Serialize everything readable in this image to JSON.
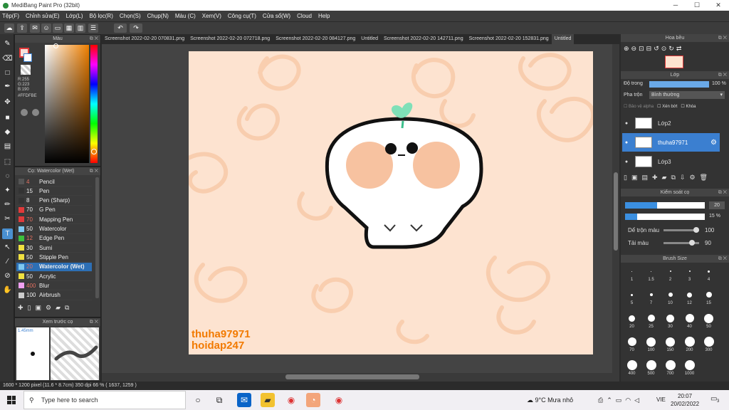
{
  "window": {
    "title": "MediBang Paint Pro (32bit)",
    "minimize": "─",
    "maximize": "☐",
    "close": "✕"
  },
  "menu": [
    "Tệp(F)",
    "Chỉnh sửa(E)",
    "Lớp(L)",
    "Bộ lọc(R)",
    "Chọn(S)",
    "Chụp(N)",
    "Màu (C)",
    "Xem(V)",
    "Công cụ(T)",
    "Cửa sổ(W)",
    "Cloud",
    "Help"
  ],
  "colors": {
    "accent": "#3b7fd0",
    "canvas_bg": "#fde3d0",
    "primary": "#f7e0da",
    "watermark": "#f27a00"
  },
  "color_panel": {
    "title": "Màu",
    "r": "R:255",
    "g": "G:223",
    "b": "B:190",
    "hex": "#FFDFBE"
  },
  "brush_panel": {
    "title": "Cọ: Watercolor (Wet)",
    "items": [
      {
        "size": "4",
        "name": "Pencil",
        "color": "#555555",
        "num_color": "#e07060"
      },
      {
        "size": "15",
        "name": "Pen",
        "color": "#333333",
        "num_color": "#eeeeee"
      },
      {
        "size": "8",
        "name": "Pen (Sharp)",
        "color": "#333333",
        "num_color": "#eeeeee"
      },
      {
        "size": "70",
        "name": "G Pen",
        "color": "#e03a3a",
        "num_color": "#eeeeee"
      },
      {
        "size": "70",
        "name": "Mapping Pen",
        "color": "#e03a3a",
        "num_color": "#e07060"
      },
      {
        "size": "50",
        "name": "Watercolor",
        "color": "#7ec8f0",
        "num_color": "#eeeeee"
      },
      {
        "size": "12",
        "name": "Edge Pen",
        "color": "#3cc03c",
        "num_color": "#e07060"
      },
      {
        "size": "30",
        "name": "Sumi",
        "color": "#f0e040",
        "num_color": "#eeeeee"
      },
      {
        "size": "50",
        "name": "Stipple Pen",
        "color": "#f0e040",
        "num_color": "#eeeeee"
      },
      {
        "size": "20",
        "name": "Watercolor (Wet)",
        "color": "#7ec8f0",
        "num_color": "#e07060",
        "selected": true
      },
      {
        "size": "50",
        "name": "Acrylic",
        "color": "#f0e040",
        "num_color": "#eeeeee"
      },
      {
        "size": "400",
        "name": "Blur",
        "color": "#f0a0f0",
        "num_color": "#e07060"
      },
      {
        "size": "100",
        "name": "Airbrush",
        "color": "#cccccc",
        "num_color": "#eeeeee"
      }
    ]
  },
  "preview_panel": {
    "title": "Xem trước cọ",
    "size": "1.45mm"
  },
  "tabs": [
    "Screenshot 2022-02-20 070831.png",
    "Screenshot 2022-02-20 072718.png",
    "Screenshot 2022-02-20 084127.png",
    "Untitled",
    "Screenshot 2022-02-20 142711.png",
    "Screenshot 2022-02-20 152831.png",
    "Untitled"
  ],
  "watermark": {
    "line1": "thuha97971",
    "line2": "hoidap247"
  },
  "navigator": {
    "title": "Hoa bều"
  },
  "layer_panel": {
    "title": "Lớp",
    "opacity_label": "Độ trong",
    "opacity_value": "100 %",
    "blend_label": "Pha trộn",
    "blend_value": "Bình thường",
    "protect_alpha": "Bảo vệ alpha",
    "clip": "Xén bớt",
    "lock": "Khóa",
    "layers": [
      {
        "name": "Lớp2",
        "selected": false
      },
      {
        "name": "thuha97971",
        "selected": true
      },
      {
        "name": "Lớp3",
        "selected": false
      }
    ]
  },
  "brush_control": {
    "title": "Kiểm soát cọ",
    "size_value": "20",
    "opacity_value": "15 %",
    "opacity_fraction": 0.15,
    "size_fraction": 0.4,
    "blend_label": "Dể trộn màu",
    "blend_value": "100",
    "mix_label": "Tải màu",
    "mix_value": "90"
  },
  "brush_size": {
    "title": "Brush Size",
    "sizes": [
      "1",
      "1.5",
      "2",
      "3",
      "4",
      "5",
      "7",
      "10",
      "12",
      "15",
      "20",
      "25",
      "30",
      "40",
      "50",
      "70",
      "100",
      "150",
      "200",
      "300",
      "400",
      "500",
      "700",
      "1000"
    ]
  },
  "status": "1600 * 1200 pixel   (11.6 * 8.7cm)   350 dpi   66 %   ( 1637, 1259 )",
  "taskbar": {
    "search_placeholder": "Type here to search",
    "weather": "9°C  Mưa nhỏ",
    "lang": "VIE",
    "time": "20:07",
    "date": "20/02/2022",
    "notify": "3"
  }
}
